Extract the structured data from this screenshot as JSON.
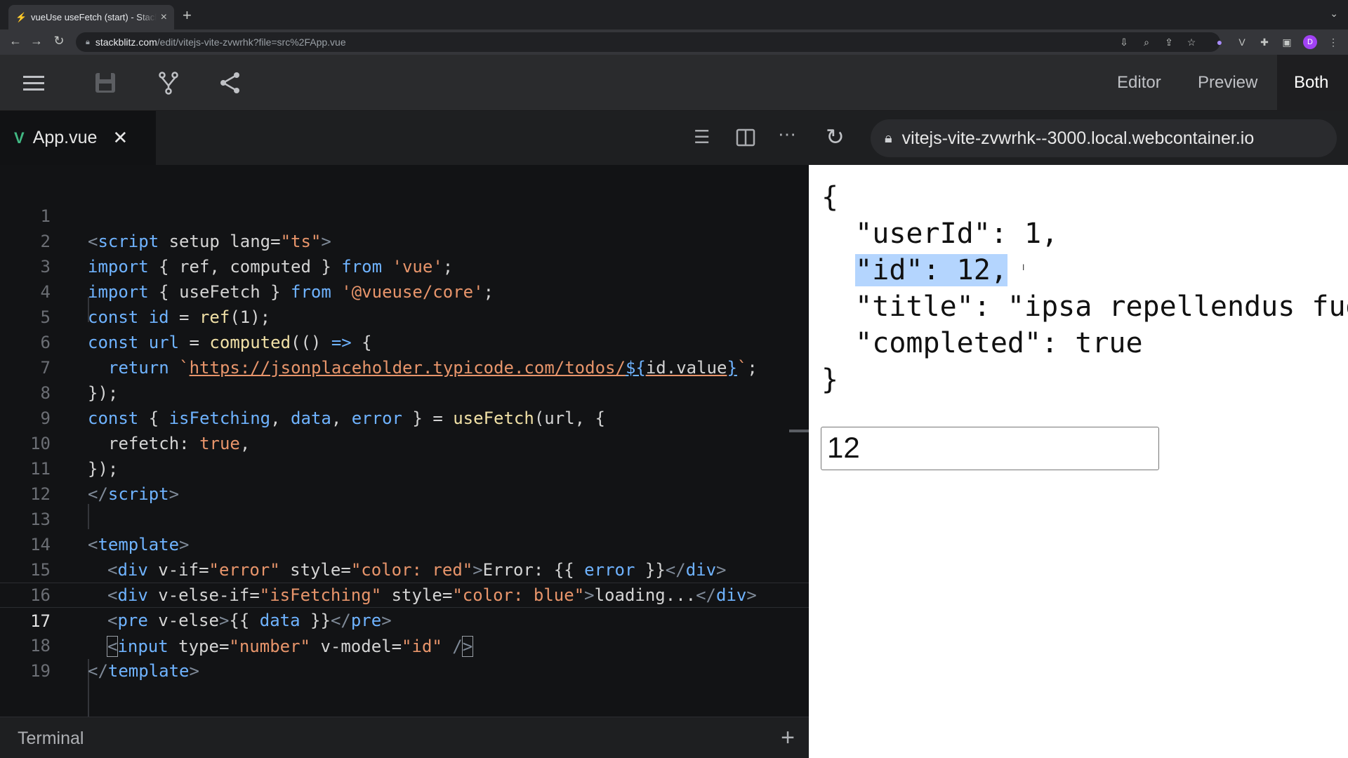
{
  "browser": {
    "tab_title": "vueUse useFetch (start) - StackBlitz",
    "url_host": "stackblitz.com",
    "url_path": "/edit/vitejs-vite-zvwrhk?file=src%2FApp.vue",
    "avatar_letter": "D"
  },
  "header": {
    "views": [
      "Editor",
      "Preview",
      "Both"
    ],
    "active_view": "Both"
  },
  "editor": {
    "file_tab": "App.vue",
    "current_line": 17,
    "line_numbers": [
      "1",
      "2",
      "3",
      "4",
      "5",
      "6",
      "7",
      "8",
      "9",
      "10",
      "11",
      "12",
      "13",
      "14",
      "15",
      "16",
      "17",
      "18",
      "19"
    ]
  },
  "code": {
    "l1": [
      "<",
      "script",
      " setup",
      " lang",
      "=",
      "\"ts\"",
      ">"
    ],
    "l2": [
      "import",
      " { ",
      "ref",
      ", ",
      "computed",
      " } ",
      "from",
      " ",
      "'vue'",
      ";"
    ],
    "l3": [
      "import",
      " { ",
      "useFetch",
      " } ",
      "from",
      " ",
      "'@vueuse/core'",
      ";"
    ],
    "l4": [
      "const",
      " ",
      "id",
      " = ",
      "ref",
      "(1);"
    ],
    "l5": [
      "const",
      " ",
      "url",
      " = ",
      "computed",
      "(() ",
      "=>",
      " {"
    ],
    "l6": [
      "return",
      " ",
      "`",
      "https://jsonplaceholder.typicode.com/todos/",
      "${",
      "id.value",
      "}",
      "`",
      ";"
    ],
    "l7": [
      "});"
    ],
    "l8": [
      "const",
      " { ",
      "isFetching",
      ", ",
      "data",
      ", ",
      "error",
      " } = ",
      "useFetch",
      "(url, {"
    ],
    "l9": [
      "refetch",
      ": ",
      "true",
      ","
    ],
    "l10": [
      "});"
    ],
    "l11": [
      "</",
      "script",
      ">"
    ],
    "l13": [
      "<",
      "template",
      ">"
    ],
    "l14": [
      "<",
      "div",
      " v-if",
      "=",
      "\"error\"",
      " style",
      "=",
      "\"color: red\"",
      ">",
      "Error: {{ ",
      "error",
      " }}",
      "</",
      "div",
      ">"
    ],
    "l15": [
      "<",
      "div",
      " v-else-if",
      "=",
      "\"isFetching\"",
      " style",
      "=",
      "\"color: blue\"",
      ">",
      "loading...",
      "</",
      "div",
      ">"
    ],
    "l16": [
      "<",
      "pre",
      " v-else",
      ">",
      "{{ ",
      "data",
      " }}",
      "</",
      "pre",
      ">"
    ],
    "l17": [
      "<",
      "input",
      " type",
      "=",
      "\"number\"",
      " v-model",
      "=",
      "\"id\"",
      " /",
      ">"
    ],
    "l18": [
      "</",
      "template",
      ">"
    ]
  },
  "terminal": {
    "label": "Terminal"
  },
  "preview": {
    "host": "vitejs-vite-zvwrhk--3000.local.webcontainer.io",
    "json_open": "{",
    "json_line1": "  \"userId\": 1,",
    "json_line2_sel": "\"id\": 12,",
    "json_line3": "  \"title\": \"ipsa repellendus fugit nisi\",",
    "json_line4": "  \"completed\": true",
    "json_close": "}",
    "input_value": "12"
  }
}
